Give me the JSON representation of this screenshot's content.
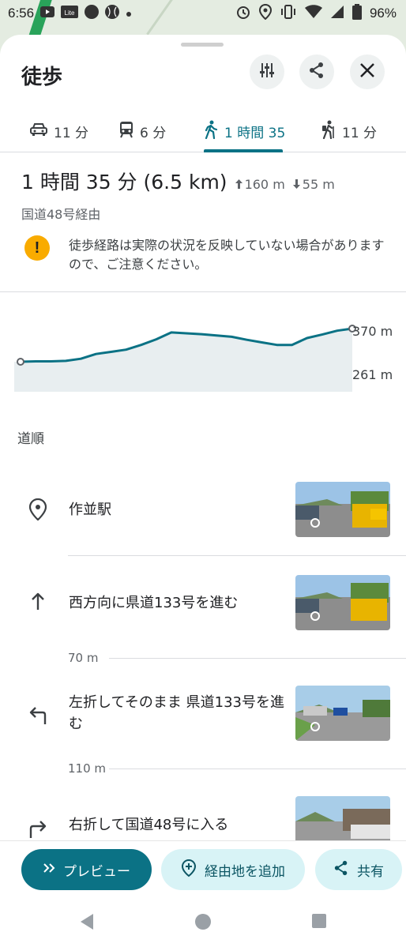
{
  "status_bar": {
    "time": "6:56",
    "app_badge": "Lite",
    "battery": "96%"
  },
  "header": {
    "title": "徒歩",
    "icons": [
      "tune-icon",
      "share-icon",
      "close-icon"
    ]
  },
  "tabs": [
    {
      "icon": "car-icon",
      "label": "11 分",
      "active": false
    },
    {
      "icon": "transit-icon",
      "label": "6 分",
      "active": false
    },
    {
      "icon": "walk-icon",
      "label": "1 時間 35",
      "active": true
    },
    {
      "icon": "hiking-icon",
      "label": "11 分",
      "active": false
    }
  ],
  "summary": {
    "duration": "1 時間 35 分 (6.5 km)",
    "ascent": "160 m",
    "descent": "55 m",
    "via": "国道48号経由"
  },
  "warning": {
    "text": "徒歩経路は実際の状況を反映していない場合がありますので、ご注意ください。"
  },
  "elevation": {
    "max_label": "370 m",
    "min_label": "261 m",
    "profile": [
      261,
      262,
      262,
      263,
      268,
      279,
      284,
      289,
      300,
      313,
      329,
      327,
      325,
      322,
      319,
      312,
      306,
      300,
      300,
      316,
      324,
      333,
      338
    ]
  },
  "steps_heading": "道順",
  "steps": [
    {
      "icon": "place-marker-icon",
      "text": "作並駅",
      "distance_after": ""
    },
    {
      "icon": "arrow-up-icon",
      "text": "西方向に県道133号を進む",
      "distance_after": "70 m"
    },
    {
      "icon": "turn-left-icon",
      "text": "左折してそのまま 県道133号を進む",
      "distance_after": "110 m"
    },
    {
      "icon": "turn-right-icon",
      "text": "右折して国道48号に入る",
      "distance_after": ""
    }
  ],
  "actions": {
    "preview": "プレビュー",
    "add_stop": "経由地を追加",
    "share": "共有"
  },
  "colors": {
    "accent": "#0b7285",
    "accent_light": "#d8f3f6",
    "warning": "#f9ab00"
  }
}
